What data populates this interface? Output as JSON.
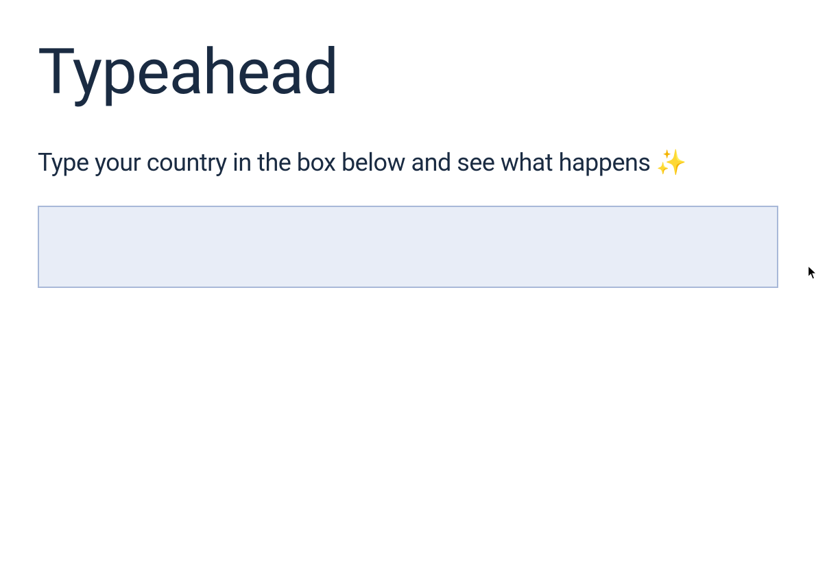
{
  "header": {
    "title": "Typeahead"
  },
  "description": {
    "text": "Type your country in the box below and see what happens ✨"
  },
  "input": {
    "value": "",
    "placeholder": ""
  }
}
